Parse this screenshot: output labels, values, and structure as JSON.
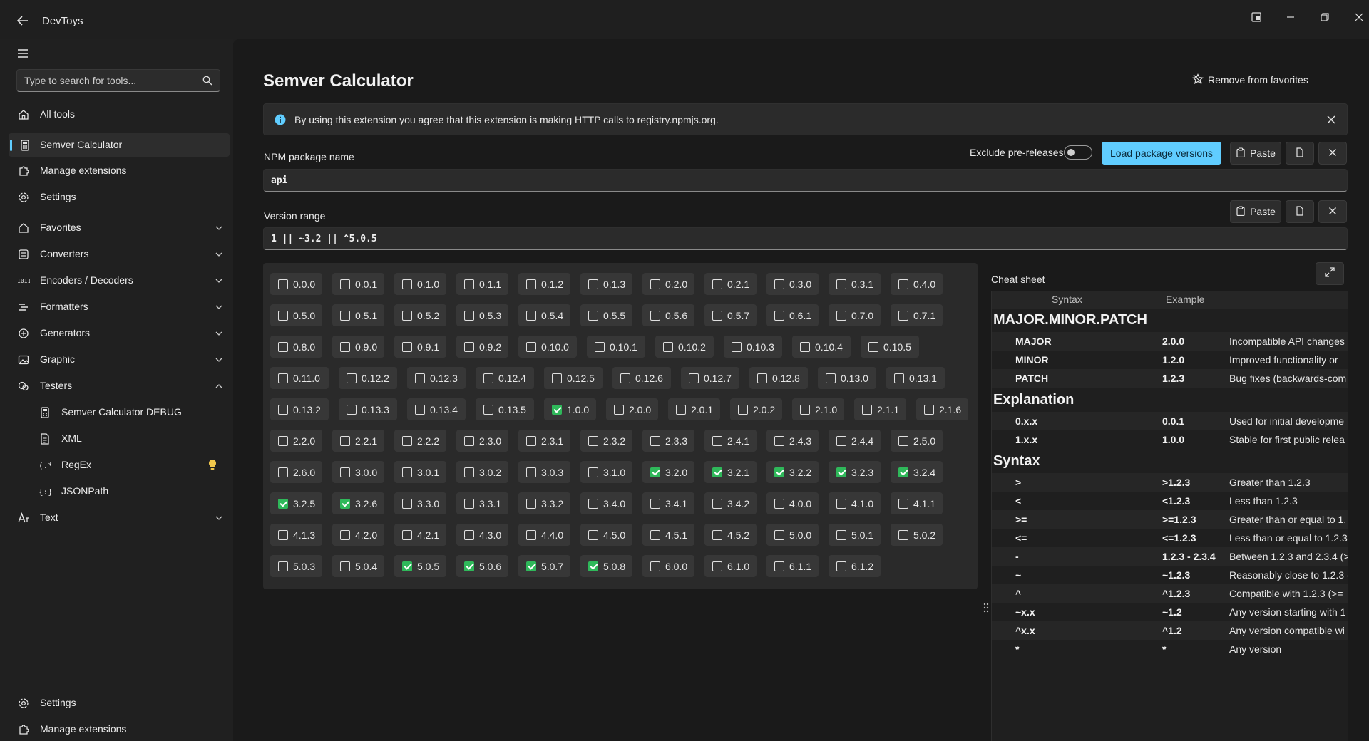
{
  "app": {
    "title": "DevToys"
  },
  "sidebar": {
    "search_placeholder": "Type to search for tools...",
    "items": [
      {
        "id": "all-tools",
        "label": "All tools",
        "icon": "home-icon"
      },
      {
        "id": "semver-calculator",
        "label": "Semver Calculator",
        "icon": "calculator-icon",
        "selected": true
      },
      {
        "id": "manage-extensions",
        "label": "Manage extensions",
        "icon": "puzzle-icon"
      },
      {
        "id": "settings",
        "label": "Settings",
        "icon": "gear-icon"
      },
      {
        "id": "favorites",
        "label": "Favorites",
        "icon": "home-icon",
        "expandable": true
      },
      {
        "id": "converters",
        "label": "Converters",
        "icon": "converter-icon",
        "expandable": true
      },
      {
        "id": "encoders",
        "label": "Encoders / Decoders",
        "icon": "binary-icon",
        "expandable": true
      },
      {
        "id": "formatters",
        "label": "Formatters",
        "icon": "lines-icon",
        "expandable": true
      },
      {
        "id": "generators",
        "label": "Generators",
        "icon": "generator-icon",
        "expandable": true
      },
      {
        "id": "graphic",
        "label": "Graphic",
        "icon": "image-icon",
        "expandable": true
      },
      {
        "id": "testers",
        "label": "Testers",
        "icon": "flask-icon",
        "expanded": true
      },
      {
        "id": "semver-debug",
        "label": "Semver Calculator DEBUG",
        "icon": "calculator-icon",
        "sub": true
      },
      {
        "id": "xml",
        "label": "XML",
        "icon": "document-icon",
        "sub": true
      },
      {
        "id": "regex",
        "label": "RegEx",
        "icon": "regex-icon",
        "sub": true
      },
      {
        "id": "jsonpath",
        "label": "JSONPath",
        "icon": "braces-icon",
        "sub": true
      },
      {
        "id": "text",
        "label": "Text",
        "icon": "text-icon",
        "expandable": true
      }
    ],
    "footer": [
      {
        "id": "settings-footer",
        "label": "Settings",
        "icon": "gear-icon"
      },
      {
        "id": "manage-ext-footer",
        "label": "Manage extensions",
        "icon": "puzzle-icon"
      }
    ]
  },
  "main": {
    "title": "Semver Calculator",
    "favorite_label": "Remove from favorites",
    "info_text": "By using this extension you agree that this extension is making HTTP calls to registry.npmjs.org.",
    "package": {
      "label": "NPM package name",
      "value": "api",
      "exclude_label": "Exclude pre-releases",
      "exclude_on": false,
      "load_label": "Load package versions",
      "paste_label": "Paste"
    },
    "range": {
      "label": "Version range",
      "value": "1 || ~3.2 || ^5.0.5",
      "paste_label": "Paste"
    },
    "versions": [
      [
        "0.0.0",
        "0.0.1",
        "0.1.0",
        "0.1.1",
        "0.1.2",
        "0.1.3",
        "0.2.0",
        "0.2.1",
        "0.3.0",
        "0.3.1",
        "0.4.0"
      ],
      [
        "0.5.0",
        "0.5.1",
        "0.5.2",
        "0.5.3",
        "0.5.4",
        "0.5.5",
        "0.5.6",
        "0.5.7",
        "0.6.1",
        "0.7.0",
        "0.7.1"
      ],
      [
        "0.8.0",
        "0.9.0",
        "0.9.1",
        "0.9.2",
        "0.10.0",
        "0.10.1",
        "0.10.2",
        "0.10.3",
        "0.10.4",
        "0.10.5"
      ],
      [
        "0.11.0",
        "0.12.2",
        "0.12.3",
        "0.12.4",
        "0.12.5",
        "0.12.6",
        "0.12.7",
        "0.12.8",
        "0.13.0",
        "0.13.1"
      ],
      [
        "0.13.2",
        "0.13.3",
        "0.13.4",
        "0.13.5",
        "1.0.0",
        "2.0.0",
        "2.0.1",
        "2.0.2",
        "2.1.0",
        "2.1.1",
        "2.1.6"
      ],
      [
        "2.2.0",
        "2.2.1",
        "2.2.2",
        "2.3.0",
        "2.3.1",
        "2.3.2",
        "2.3.3",
        "2.4.1",
        "2.4.3",
        "2.4.4",
        "2.5.0"
      ],
      [
        "2.6.0",
        "3.0.0",
        "3.0.1",
        "3.0.2",
        "3.0.3",
        "3.1.0",
        "3.2.0",
        "3.2.1",
        "3.2.2",
        "3.2.3",
        "3.2.4"
      ],
      [
        "3.2.5",
        "3.2.6",
        "3.3.0",
        "3.3.1",
        "3.3.2",
        "3.4.0",
        "3.4.1",
        "3.4.2",
        "4.0.0",
        "4.1.0",
        "4.1.1"
      ],
      [
        "4.1.3",
        "4.2.0",
        "4.2.1",
        "4.3.0",
        "4.4.0",
        "4.5.0",
        "4.5.1",
        "4.5.2",
        "5.0.0",
        "5.0.1",
        "5.0.2"
      ],
      [
        "5.0.3",
        "5.0.4",
        "5.0.5",
        "5.0.6",
        "5.0.7",
        "5.0.8",
        "6.0.0",
        "6.1.0",
        "6.1.1",
        "6.1.2"
      ]
    ],
    "checked": [
      "1.0.0",
      "3.2.0",
      "3.2.1",
      "3.2.2",
      "3.2.3",
      "3.2.4",
      "3.2.5",
      "3.2.6",
      "5.0.5",
      "5.0.6",
      "5.0.7",
      "5.0.8"
    ]
  },
  "cheatsheet": {
    "title": "Cheat sheet",
    "col_syntax": "Syntax",
    "col_example": "Example",
    "sections": [
      {
        "title": "MAJOR.MINOR.PATCH",
        "rows": [
          [
            "MAJOR",
            "2.0.0",
            "Incompatible API changes"
          ],
          [
            "MINOR",
            "1.2.0",
            "Improved functionality or"
          ],
          [
            "PATCH",
            "1.2.3",
            "Bug fixes (backwards-com"
          ]
        ]
      },
      {
        "title": "Explanation",
        "rows": [
          [
            "0.x.x",
            "0.0.1",
            "Used for initial developme"
          ],
          [
            "1.x.x",
            "1.0.0",
            "Stable for first public relea"
          ]
        ]
      },
      {
        "title": "Syntax",
        "rows": [
          [
            ">",
            ">1.2.3",
            "Greater than 1.2.3"
          ],
          [
            "<",
            "<1.2.3",
            "Less than 1.2.3"
          ],
          [
            ">=",
            ">=1.2.3",
            "Greater than or equal to 1."
          ],
          [
            "<=",
            "<=1.2.3",
            "Less than or equal to 1.2.3"
          ],
          [
            "-",
            "1.2.3 - 2.3.4",
            "Between 1.2.3 and 2.3.4 (>"
          ],
          [
            "~",
            "~1.2.3",
            "Reasonably close to 1.2.3 ("
          ],
          [
            "^",
            "^1.2.3",
            "Compatible with 1.2.3 (>="
          ],
          [
            "~x.x",
            "~1.2",
            "Any version starting with 1"
          ],
          [
            "^x.x",
            "^1.2",
            "Any version compatible wi"
          ],
          [
            "*",
            "*",
            "Any version"
          ]
        ]
      }
    ]
  },
  "colors": {
    "accent": "#60cdff",
    "checked": "#2fb85a",
    "bulb": "#f2c84b"
  }
}
